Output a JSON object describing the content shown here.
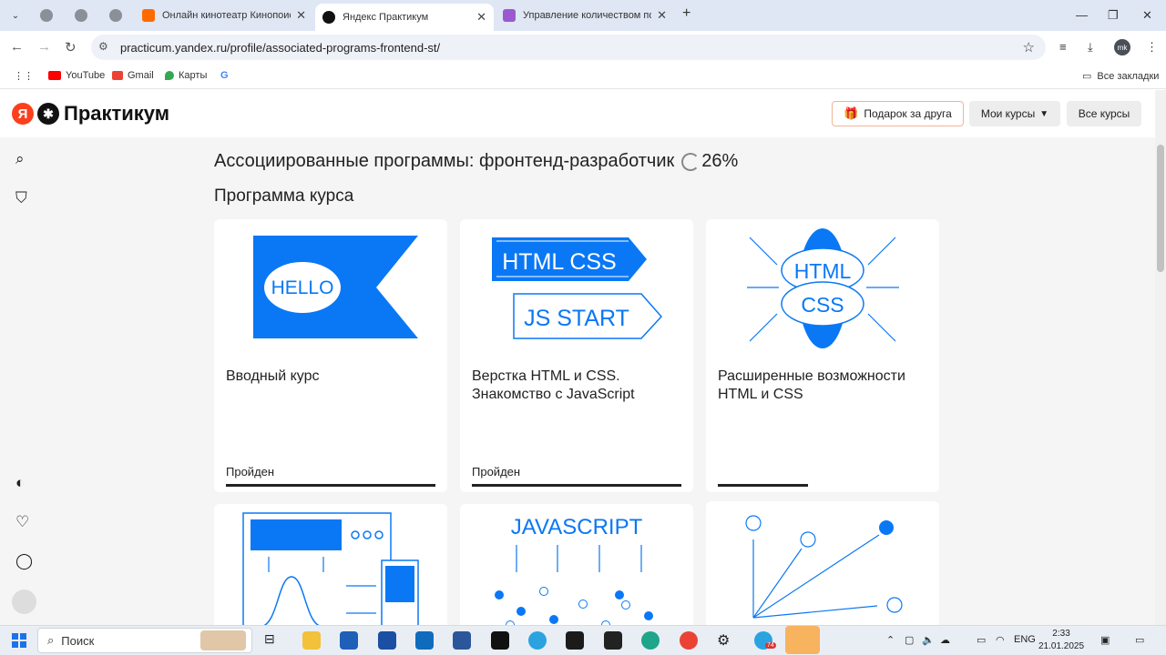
{
  "browser": {
    "tabs": [
      {
        "title": "Онлайн кинотеатр Кинопоиск"
      },
      {
        "title": "Яндекс Практикум"
      },
      {
        "title": "Управление количеством пов"
      }
    ],
    "url": "practicum.yandex.ru/profile/associated-programs-frontend-st/",
    "profile_initials": "mk",
    "bookmarks": [
      "YouTube",
      "Gmail",
      "Карты",
      "G"
    ],
    "all_bookmarks": "Все закладки"
  },
  "header": {
    "logo_text": "Практикум",
    "logo_ya": "Я",
    "gift_label": "Подарок за друга",
    "my_courses_label": "Мои курсы",
    "all_courses_label": "Все курсы"
  },
  "main": {
    "title": "Ассоциированные программы: фронтенд-разработчик",
    "progress_text": "26%",
    "progress": 0.26,
    "section_title": "Программа курса",
    "cards": [
      {
        "title": "Вводный курс",
        "status": "Пройден",
        "progress": 1.0,
        "art": {
          "text": "HELLO"
        }
      },
      {
        "title": "Верстка HTML и CSS. Знакомство с JavaScript",
        "status": "Пройден",
        "progress": 1.0,
        "art": {
          "line1": "HTML CSS",
          "line2": "JS START"
        }
      },
      {
        "title": "Расширенные возможности HTML и CSS",
        "status": "",
        "progress": 0.43,
        "art": {
          "line1": "HTML",
          "line2": "CSS"
        }
      },
      {
        "title": "",
        "status": "",
        "art": {}
      },
      {
        "title": "",
        "status": "",
        "art": {
          "text": "JAVASCRIPT"
        }
      },
      {
        "title": "",
        "status": "",
        "art": {}
      }
    ]
  },
  "colors": {
    "accent": "#0a78f5",
    "brand_ya": "#fc3f1d"
  },
  "taskbar": {
    "search_placeholder": "Поиск",
    "lang": "ENG",
    "time": "2:33",
    "date": "21.01.2025",
    "telegram_badge": "74"
  }
}
